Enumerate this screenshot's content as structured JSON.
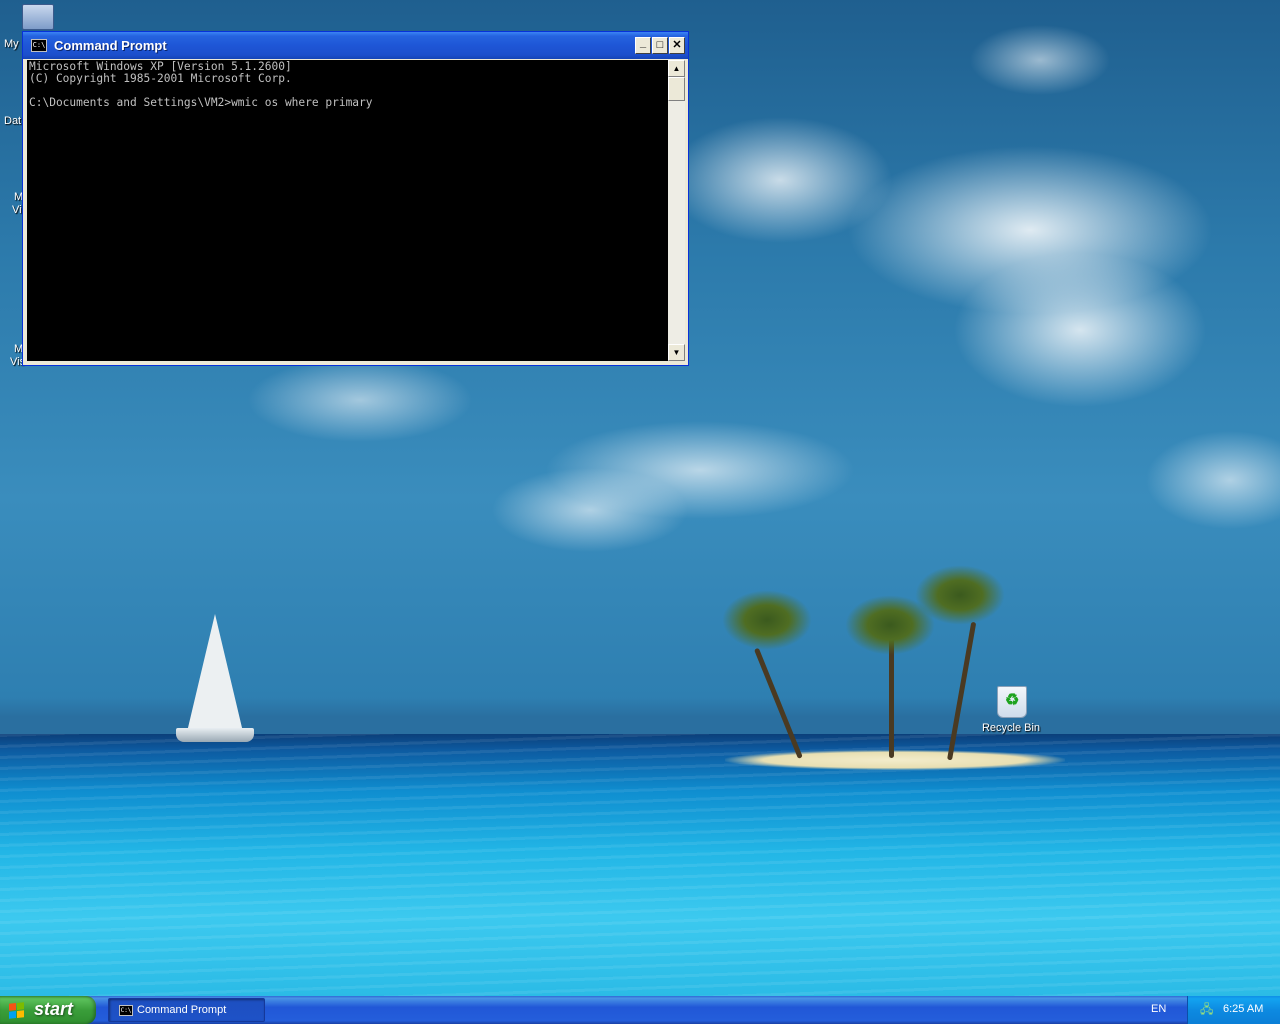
{
  "desktop": {
    "icons": [
      {
        "label_partial": "My"
      },
      {
        "label_partial": "Dat"
      },
      {
        "label_partial": "M"
      },
      {
        "label_partial": "Vi"
      },
      {
        "label_partial": "M"
      },
      {
        "label_partial": "Vis"
      }
    ],
    "recycle_bin_label": "Recycle Bin"
  },
  "window": {
    "title": "Command Prompt",
    "icon_glyph": "C:\\",
    "controls": {
      "minimize": "_",
      "maximize": "□",
      "close": "✕"
    },
    "console_text": "Microsoft Windows XP [Version 5.1.2600]\n(C) Copyright 1985-2001 Microsoft Corp.\n\nC:\\Documents and Settings\\VM2>wmic os where primary"
  },
  "taskbar": {
    "start_label": "start",
    "tasks": [
      {
        "label": "Command Prompt",
        "icon_glyph": "C:\\"
      }
    ],
    "language": "EN",
    "clock": "6:25 AM"
  },
  "colors": {
    "titlebar": "#2563e0",
    "taskbar": "#245edb",
    "start_button": "#3a9e3a",
    "console_background": "#000000",
    "console_text": "#c0c0c0"
  }
}
